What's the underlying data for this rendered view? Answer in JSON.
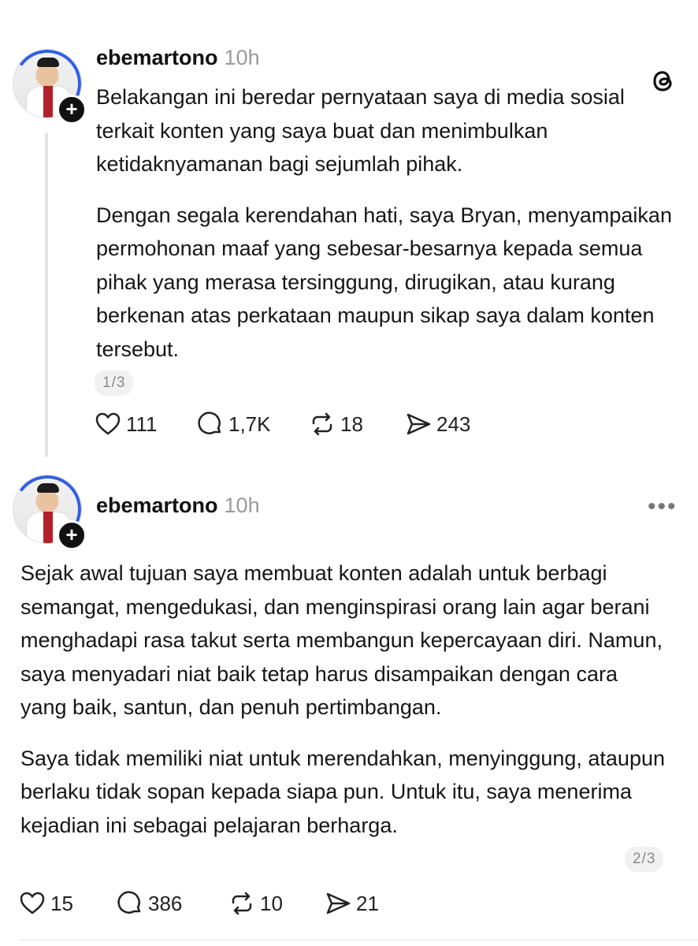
{
  "post1": {
    "username": "ebemartono",
    "time": "10h",
    "paragraphs": [
      "Belakangan ini beredar pernyataan saya di media sosial terkait konten yang saya buat dan menimbulkan ketidaknyamanan bagi sejumlah pihak.",
      "Dengan segala kerendahan hati, saya Bryan, menyampaikan permohonan maaf yang sebesar-besarnya kepada semua pihak yang merasa tersinggung, dirugikan, atau kurang berkenan atas perkataan maupun sikap saya dalam konten tersebut."
    ],
    "pager": "1/3",
    "likes": "111",
    "comments": "1,7K",
    "reposts": "18",
    "shares": "243",
    "corner_icon": "threads-logo-icon"
  },
  "post2": {
    "username": "ebemartono",
    "time": "10h",
    "paragraphs": [
      "Sejak awal tujuan saya membuat konten adalah untuk berbagi semangat, mengedukasi, dan menginspirasi orang lain agar berani menghadapi rasa takut serta membangun kepercayaan diri. Namun, saya menyadari niat baik tetap harus disampaikan dengan cara yang baik, santun, dan penuh pertimbangan.",
      "Saya tidak memiliki niat untuk merendahkan, menyinggung, ataupun berlaku tidak sopan kepada siapa pun. Untuk itu, saya menerima kejadian ini sebagai pelajaran berharga."
    ],
    "pager": "2/3",
    "likes": "15",
    "comments": "386",
    "reposts": "10",
    "shares": "21",
    "more_label": "•••"
  },
  "follow_plus": "+",
  "colors": {
    "text": "#161616",
    "muted": "#9a9a9a",
    "ring": "#2f5fe8",
    "thread_line": "#e3e3e3"
  }
}
